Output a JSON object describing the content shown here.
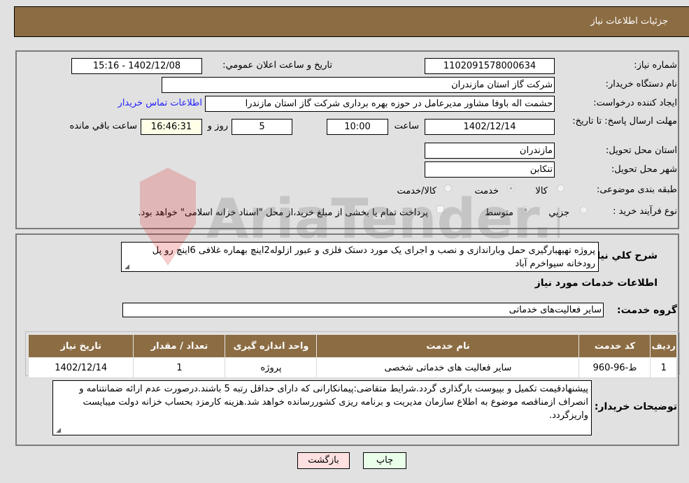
{
  "header": {
    "title": "جزئیات اطلاعات نیاز"
  },
  "info": {
    "need_number_label": "شماره نیاز:",
    "need_number": "1102091578000634",
    "announce_label": "تاريخ و ساعت اعلان عمومي:",
    "announce_value": "1402/12/08 - 15:16",
    "buyer_org_label": "نام دستگاه خريدار:",
    "buyer_org": "شرکت گاز استان مازندران",
    "creator_label": "ايجاد کننده درخواست:",
    "creator": "حشمت اله باوفا مشاور مديرعامل در حوزه بهره برداری  شرکت گاز استان مازندرا",
    "contact_link": "اطلاعات تماس خريدار",
    "deadline_label": "مهلت ارسال پاسخ: تا تاريخ:",
    "deadline_date": "1402/12/14",
    "time_label": "ساعت",
    "deadline_time": "10:00",
    "days_value": "5",
    "days_label": "روز و",
    "remaining_time": "16:46:31",
    "remaining_label": "ساعت باقي مانده",
    "province_label": "استان محل تحويل:",
    "province": "مازندران",
    "city_label": "شهر محل تحويل:",
    "city": "تنکابن",
    "category_label": "طبقه بندی موضوعی:",
    "category_options": [
      {
        "label": "کالا",
        "checked": false
      },
      {
        "label": "خدمت",
        "checked": true
      },
      {
        "label": "کالا/خدمت",
        "checked": false
      }
    ],
    "process_label": "نوع فرآيند خريد :",
    "process_options": [
      {
        "label": "جزيي",
        "checked": false
      },
      {
        "label": "متوسط",
        "checked": true
      }
    ],
    "treasury_note": "پرداخت تمام يا بخشی از مبلغ خريد،از محل \"اسناد خزانه اسلامی\" خواهد بود."
  },
  "description": {
    "label": "شرح کلي نياز:",
    "text": "پروژه تهیهبارگیری حمل وباراندازی و نصب و اجرای یک مورد دستک فلزی و عبور ازلوله2اینچ بهماره غلافی 6اینچ رو پل رودخانه سیواخرم آباد"
  },
  "services": {
    "section_title": "اطلاعات خدمات مورد نياز",
    "group_label": "گروه خدمت:",
    "group_value": "سایر فعالیت‌های خدماتی",
    "columns": [
      "رديف",
      "کد خدمت",
      "نام خدمت",
      "واحد اندازه گيری",
      "تعداد / مقدار",
      "تاريخ نياز"
    ],
    "rows": [
      [
        "1",
        "ط-96-960",
        "سایر فعالیت های خدماتی شخصی",
        "پروژه",
        "1",
        "1402/12/14"
      ]
    ]
  },
  "buyer_notes": {
    "label": "توضيحات خريدار:",
    "text": "پیشنهادقیمت تکمیل و بپیوست بارگذاری گردد.شرایط متقاضی:پیمانکارانی که دارای حداقل رتبه 5 باشند.درصورت عدم ارائه ضمانتنامه و انصراف ازمناقصه موضوع به اطلاع سازمان مدیریت و برنامه ریزی کشوررسانده خواهد شد.هزینه کارمزد بحساب خزانه دولت میبایست واریزگردد."
  },
  "buttons": {
    "print": "چاپ",
    "back": "بازگشت"
  },
  "watermark": {
    "text": "AriaTender.neT"
  }
}
